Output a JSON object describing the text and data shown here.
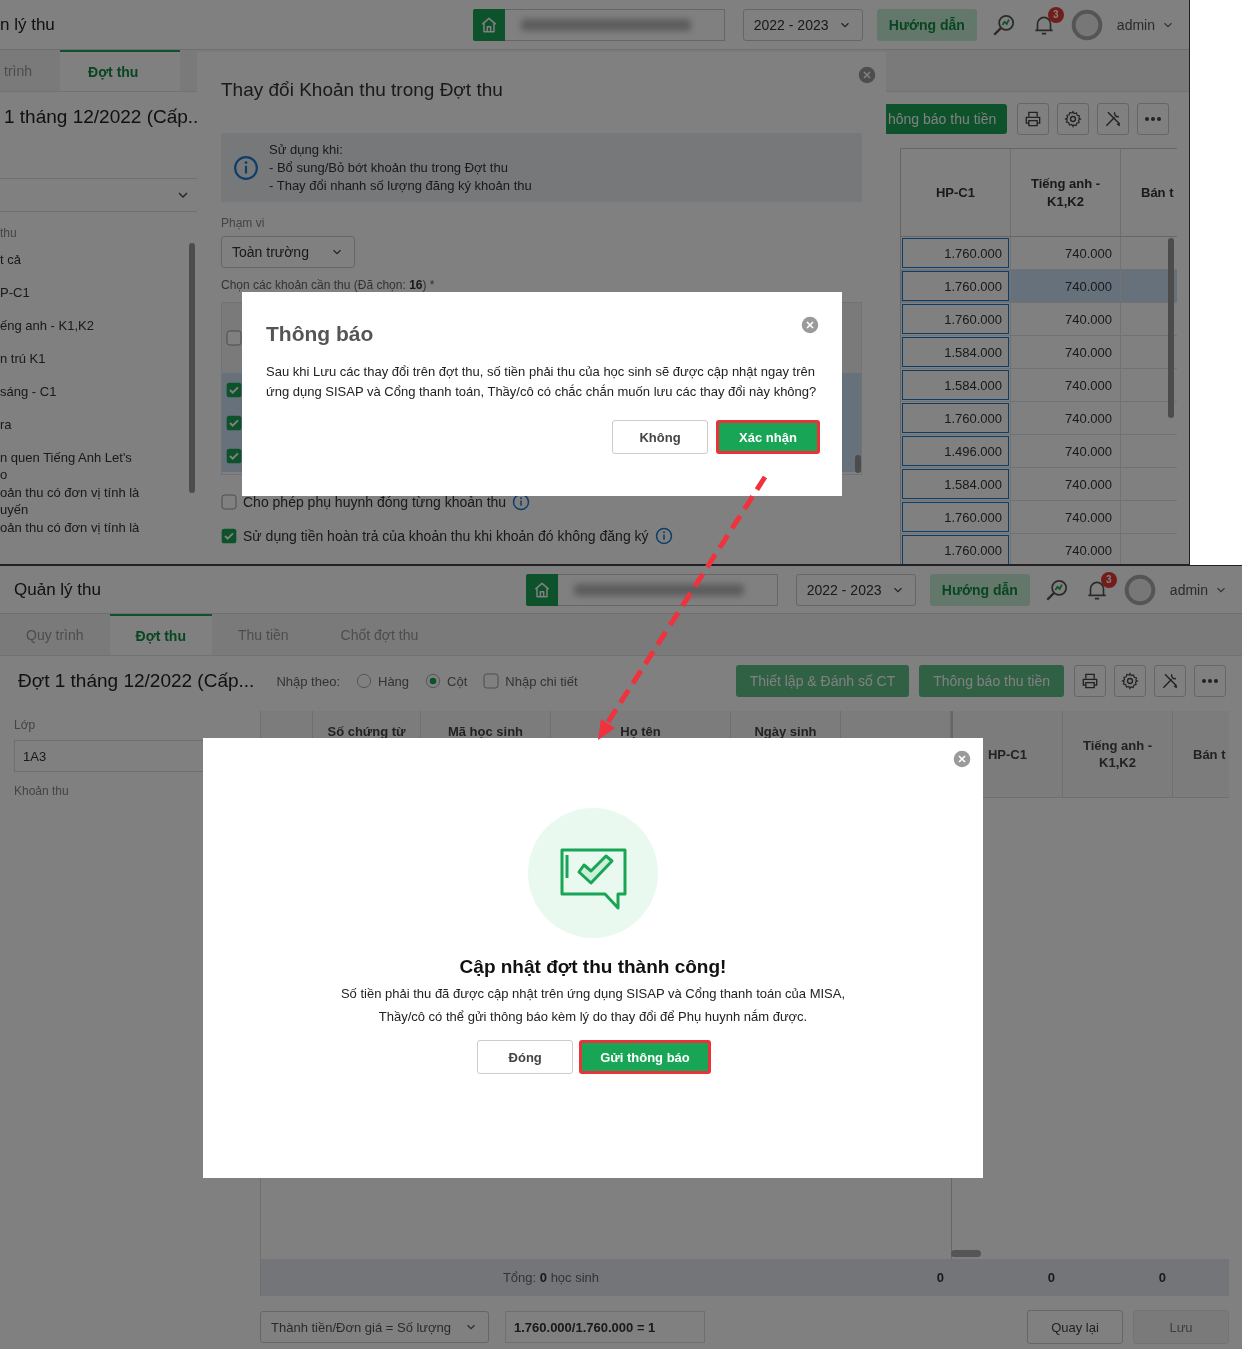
{
  "top_screenshot": {
    "header": {
      "title": "n lý thu",
      "year": "2022 - 2023",
      "guide_button": "Hướng dẫn",
      "notification_count": "3",
      "user": "admin"
    },
    "tabs": [
      {
        "label": "trình",
        "selected": false
      },
      {
        "label": "Đợt thu",
        "selected": true
      }
    ],
    "page_title": "1 tháng 12/2022 (Cấp..",
    "sidebar": {
      "label": "thu",
      "items": [
        "t cả",
        "P-C1",
        "ếng anh - K1,K2",
        "n trú K1",
        "sáng - C1",
        "ra",
        "n quen Tiếng Anh Let's\no",
        "oản thu có đơn vị tính là\nuyến",
        "oản thu có đơn vị tính là"
      ]
    },
    "toolbar": {
      "notify_button": "hông báo thu tiền"
    },
    "table": {
      "columns": [
        "HP-C1",
        "Tiếng anh -\nK1,K2",
        "Bán t"
      ],
      "rows": [
        {
          "selected": false,
          "cells": [
            "1.760.000",
            "740.000"
          ]
        },
        {
          "selected": true,
          "cells": [
            "1.760.000",
            "740.000"
          ]
        },
        {
          "selected": false,
          "cells": [
            "1.760.000",
            "740.000"
          ]
        },
        {
          "selected": false,
          "cells": [
            "1.584.000",
            "740.000"
          ]
        },
        {
          "selected": false,
          "cells": [
            "1.584.000",
            "740.000"
          ]
        },
        {
          "selected": false,
          "cells": [
            "1.760.000",
            "740.000"
          ]
        },
        {
          "selected": false,
          "cells": [
            "1.496.000",
            "740.000"
          ]
        },
        {
          "selected": false,
          "cells": [
            "1.584.000",
            "740.000"
          ]
        },
        {
          "selected": false,
          "cells": [
            "1.760.000",
            "740.000"
          ]
        },
        {
          "selected": false,
          "cells": [
            "1.760.000",
            "740.000"
          ]
        }
      ]
    },
    "side_panel": {
      "title": "Thay đổi Khoản thu trong Đợt thu",
      "info_lines": [
        "Sử dụng khi:",
        "- Bổ sung/Bỏ bớt khoản thu trong Đợt thu",
        "- Thay đổi nhanh số lượng đăng ký khoản thu"
      ],
      "scope_label": "Phạm vi",
      "scope_value": "Toàn trường",
      "items_label": "Chọn các khoản cần thu (Đã chọn: **16**) *",
      "item_checks": [
        {
          "checked": false
        },
        {
          "checked": true
        },
        {
          "checked": true
        },
        {
          "checked": true
        }
      ],
      "options": [
        {
          "label": "Cho phép phụ huynh đóng từng khoản thu",
          "checked": false
        },
        {
          "label": "Sử dụng tiền hoàn trả của khoản thu khi khoản đó không đăng ký",
          "checked": true
        }
      ]
    },
    "dialog": {
      "title": "Thông báo",
      "message": "Sau khi Lưu các thay đổi trên đợt thu, số tiền phải thu của học sinh sẽ được cập nhật ngay trên ứng dụng SISAP và Cổng thanh toán, Thầy/cô có chắc chắn muốn lưu các thay đổi này không?",
      "buttons": [
        {
          "label": "Không",
          "kind": "secondary",
          "highlighted": false
        },
        {
          "label": "Xác nhận",
          "kind": "primary",
          "highlighted": true
        }
      ]
    }
  },
  "bottom_screenshot": {
    "header": {
      "title": "Quản lý thu",
      "year": "2022 - 2023",
      "guide_button": "Hướng dẫn",
      "notification_count": "3",
      "user": "admin"
    },
    "tabs": [
      {
        "label": "Quy trình",
        "selected": false
      },
      {
        "label": "Đợt thu",
        "selected": true
      },
      {
        "label": "Thu tiền",
        "selected": false
      },
      {
        "label": "Chốt đợt thu",
        "selected": false
      }
    ],
    "page_title": "Đợt 1 tháng 12/2022 (Cấp...",
    "entry_mode": {
      "label": "Nhập theo:",
      "options": [
        {
          "label": "Hàng",
          "selected": false
        },
        {
          "label": "Cột",
          "selected": true
        }
      ]
    },
    "detail_entry": {
      "label": "Nhập chi tiết",
      "checked": false
    },
    "buttons": [
      "Thiết lập & Đánh số CT",
      "Thông báo thu tiền"
    ],
    "filters": {
      "class_label": "Lớp",
      "class_value": "1A3",
      "fee_label": "Khoản thu"
    },
    "table": {
      "columns": [
        "Số chứng từ",
        "Mã học sinh",
        "Họ tên",
        "Ngày sinh"
      ],
      "fee_columns": [
        "HP-C1",
        "Tiếng anh -\nK1,K2",
        "Bán t"
      ],
      "totals": [
        "Tổng: **0** học sinh",
        "0",
        "0",
        "0"
      ]
    },
    "footer": {
      "formula": "Thành tiền/Đơn giá = Số lượng",
      "result": "1.760.000/1.760.000 = 1",
      "back_button": "Quay lại",
      "save_button": {
        "label": "Lưu",
        "disabled": true
      }
    },
    "dialog": {
      "title": "Cập nhật đợt thu thành công!",
      "message_lines": [
        "Số tiền phải thu đã được cập nhật trên ứng dụng SISAP và Cổng thanh toán của MISA,",
        "Thầy/cô có thể gửi thông báo kèm lý do thay đổi để Phụ huynh nắm được."
      ],
      "buttons": [
        {
          "label": "Đóng",
          "kind": "secondary",
          "highlighted": false
        },
        {
          "label": "Gửi thông báo",
          "kind": "primary",
          "highlighted": true
        }
      ]
    }
  }
}
